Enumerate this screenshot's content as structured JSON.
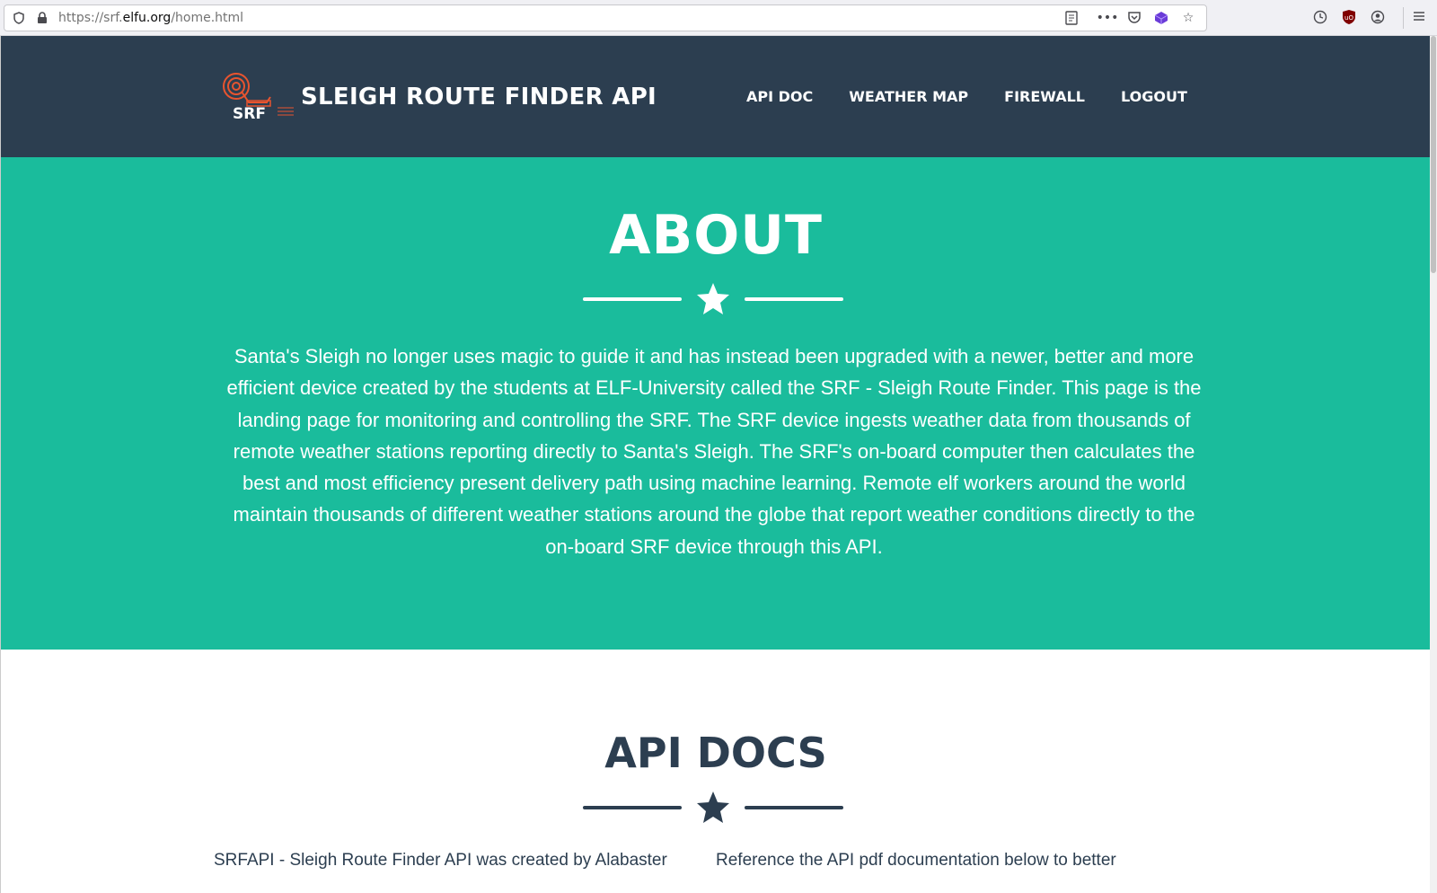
{
  "browser": {
    "url_prefix": "https://srf.",
    "url_domain": "elfu.org",
    "url_path": "/home.html"
  },
  "navbar": {
    "brand_title": "SLEIGH ROUTE FINDER API",
    "logo_text": "SRF",
    "links": [
      "API DOC",
      "WEATHER MAP",
      "FIREWALL",
      "LOGOUT"
    ]
  },
  "about": {
    "heading": "ABOUT",
    "body": "Santa's Sleigh no longer uses magic to guide it and has instead been upgraded with a newer, better and more efficient device created by the students at ELF-University called the SRF - Sleigh Route Finder. This page is the landing page for monitoring and controlling the SRF. The SRF device ingests weather data from thousands of remote weather stations reporting directly to Santa's Sleigh. The SRF's on-board computer then calculates the best and most efficiency present delivery path using machine learning. Remote elf workers around the world maintain thousands of different weather stations around the globe that report weather conditions directly to the on-board SRF device through this API."
  },
  "api_docs": {
    "heading": "API DOCS",
    "col_left": "SRFAPI - Sleigh Route Finder API was created by Alabaster",
    "col_right": "Reference the API pdf documentation below to better"
  },
  "colors": {
    "navbar": "#2c3e50",
    "about_bg": "#1abc9c",
    "logo_accent": "#e8542f"
  }
}
